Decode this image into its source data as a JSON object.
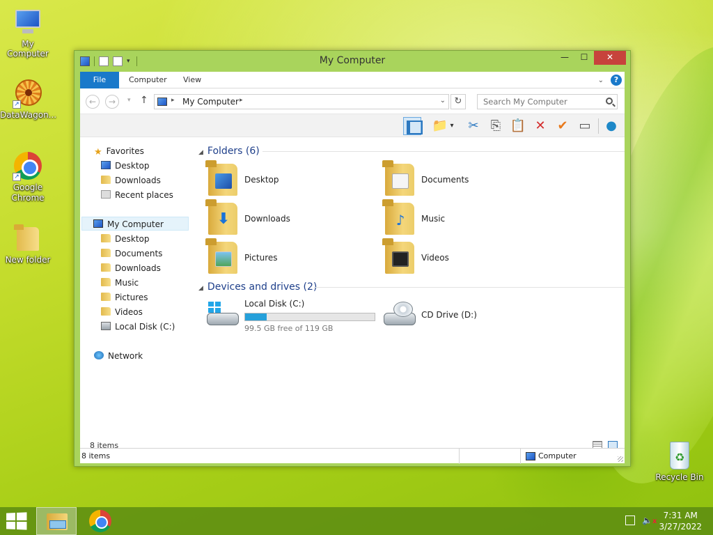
{
  "desktop": {
    "icons": [
      {
        "label": "My Computer",
        "icon": "my-computer-icon"
      },
      {
        "label": "DataWagon...",
        "icon": "datawagon-icon"
      },
      {
        "label": "Google Chrome",
        "icon": "chrome-icon"
      },
      {
        "label": "New folder",
        "icon": "folder-icon"
      },
      {
        "label": "Recycle Bin",
        "icon": "recycle-bin-icon"
      }
    ]
  },
  "window": {
    "title": "My Computer",
    "controls": {
      "minimize": "—",
      "maximize": "☐",
      "close": "✕"
    },
    "ribbon": {
      "tabs": [
        {
          "label": "File",
          "active": true
        },
        {
          "label": "Computer"
        },
        {
          "label": "View"
        }
      ],
      "expand_label": "⌄",
      "help_label": "?"
    },
    "address": {
      "path": "My Computer",
      "search_placeholder": "Search My Computer"
    },
    "sidebar": {
      "favorites_label": "Favorites",
      "favorites": [
        {
          "label": "Desktop",
          "icon": "desktop-icon"
        },
        {
          "label": "Downloads",
          "icon": "downloads-folder-icon"
        },
        {
          "label": "Recent places",
          "icon": "recent-places-icon"
        }
      ],
      "computer_label": "My Computer",
      "computer_items": [
        {
          "label": "Desktop",
          "icon": "desktop-folder-icon"
        },
        {
          "label": "Documents",
          "icon": "documents-folder-icon"
        },
        {
          "label": "Downloads",
          "icon": "downloads-folder-icon"
        },
        {
          "label": "Music",
          "icon": "music-folder-icon"
        },
        {
          "label": "Pictures",
          "icon": "pictures-folder-icon"
        },
        {
          "label": "Videos",
          "icon": "videos-folder-icon"
        },
        {
          "label": "Local Disk (C:)",
          "icon": "local-disk-icon"
        }
      ],
      "network_label": "Network"
    },
    "content": {
      "folders_header": "Folders (6)",
      "folders": [
        {
          "name": "Desktop",
          "icon": "desktop-folder-icon"
        },
        {
          "name": "Documents",
          "icon": "documents-folder-icon"
        },
        {
          "name": "Downloads",
          "icon": "downloads-folder-icon"
        },
        {
          "name": "Music",
          "icon": "music-folder-icon"
        },
        {
          "name": "Pictures",
          "icon": "pictures-folder-icon"
        },
        {
          "name": "Videos",
          "icon": "videos-folder-icon"
        }
      ],
      "devices_header": "Devices and drives (2)",
      "drives": [
        {
          "name": "Local Disk (C:)",
          "free_text": "99.5 GB free of 119 GB",
          "used_fraction": 0.164
        },
        {
          "name": "CD Drive (D:)"
        }
      ],
      "items_count": "8 items"
    },
    "statusbar": {
      "items_count": "8 items",
      "location": "Computer"
    }
  },
  "taskbar": {
    "time": "7:31 AM",
    "date": "3/27/2022"
  },
  "colors": {
    "accent": "#1979ca",
    "group_header": "#1e3f8a",
    "drive_bar": "#26a0da",
    "close_button": "#c7433c"
  }
}
